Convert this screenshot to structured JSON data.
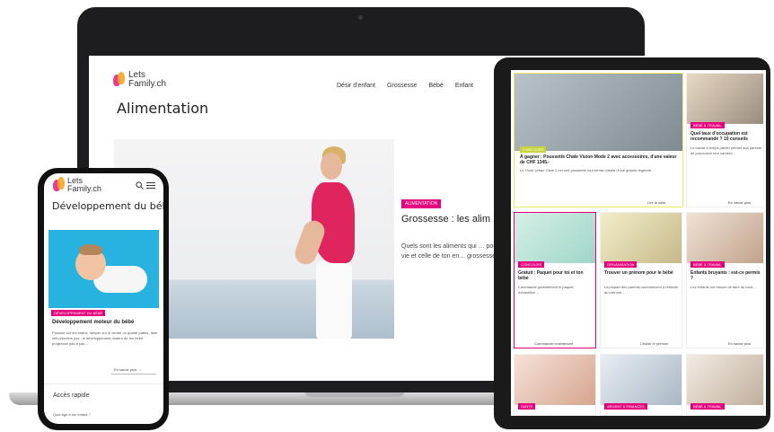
{
  "laptop": {
    "logo_line1": "Lets",
    "logo_line2": "Family.ch",
    "nav": [
      "Désir d'enfant",
      "Grossesse",
      "Bébé",
      "Enfant"
    ],
    "page_title": "Alimentation",
    "hero_badge": "ALIMENTATION",
    "hero_heading": "Grossesse : les alim",
    "hero_text": "Quels sont les aliments qui … pour ta vie et celle de ton en… grossesse ?"
  },
  "tablet": {
    "cards": [
      {
        "badge": "CONCOURS",
        "title": "À gagner : Poussette Chale Vision Mode 2 avec accessoires, d'une valeur de CHF 1345.-",
        "body": "Le Thule Urban Glide 2 est une poussette tout-terrain idéale d'une grande légèreté…",
        "more": "Lire la suite"
      },
      {
        "badge": "BÉBÉ & TRAVAIL",
        "title": "Quel taux d'occupation est recommandé ? 10 conseils",
        "body": "Le travail à temps partiel permet aux parents de poursuivre leur carrière…",
        "more": "En savoir plus"
      },
      {
        "badge": "CONCOURS",
        "title": "Gratuit : Paquet pour toi et ton bébé",
        "body": "Commande gratuitement le paquet échantillon…",
        "more": "Commander maintenant"
      },
      {
        "badge": "ORGANISATION",
        "title": "Trouver un prénom pour le bébé",
        "body": "La plupart des parents commencent à réfléchir au prénom…",
        "more": "Choisir le prénom"
      },
      {
        "badge": "BÉBÉ & TRAVAIL",
        "title": "Enfants bruyants : est-ce permis ?",
        "body": "Les enfants ont besoin de faire du bruit…",
        "more": "En savoir plus"
      },
      {
        "badge": "SANTÉ",
        "title": "",
        "body": "",
        "more": ""
      },
      {
        "badge": "ARGENT & FINANCES",
        "title": "",
        "body": "",
        "more": ""
      },
      {
        "badge": "BÉBÉ & TRAVAIL",
        "title": "",
        "body": "",
        "more": ""
      }
    ]
  },
  "phone": {
    "logo_line1": "Lets",
    "logo_line2": "Family.ch",
    "page_title": "Développement du bébé",
    "hero_badge": "DÉVELOPPEMENT DU BÉBÉ",
    "hero_heading": "Développement moteur du bébé",
    "hero_text": "Pousser sur les mains, ramper sur le ventre ou quatre pattes, faire ses premiers pas : le développement moteur de ton bébé progresse pas à pas…",
    "more": "En savoir plus",
    "quick_access": "Accès rapide",
    "question": "Quel âge a ton enfant ?"
  },
  "colors": {
    "brand_pink": "#e6007e",
    "logo_orange": "#f5a623",
    "device_frame": "#1a1a1a"
  }
}
